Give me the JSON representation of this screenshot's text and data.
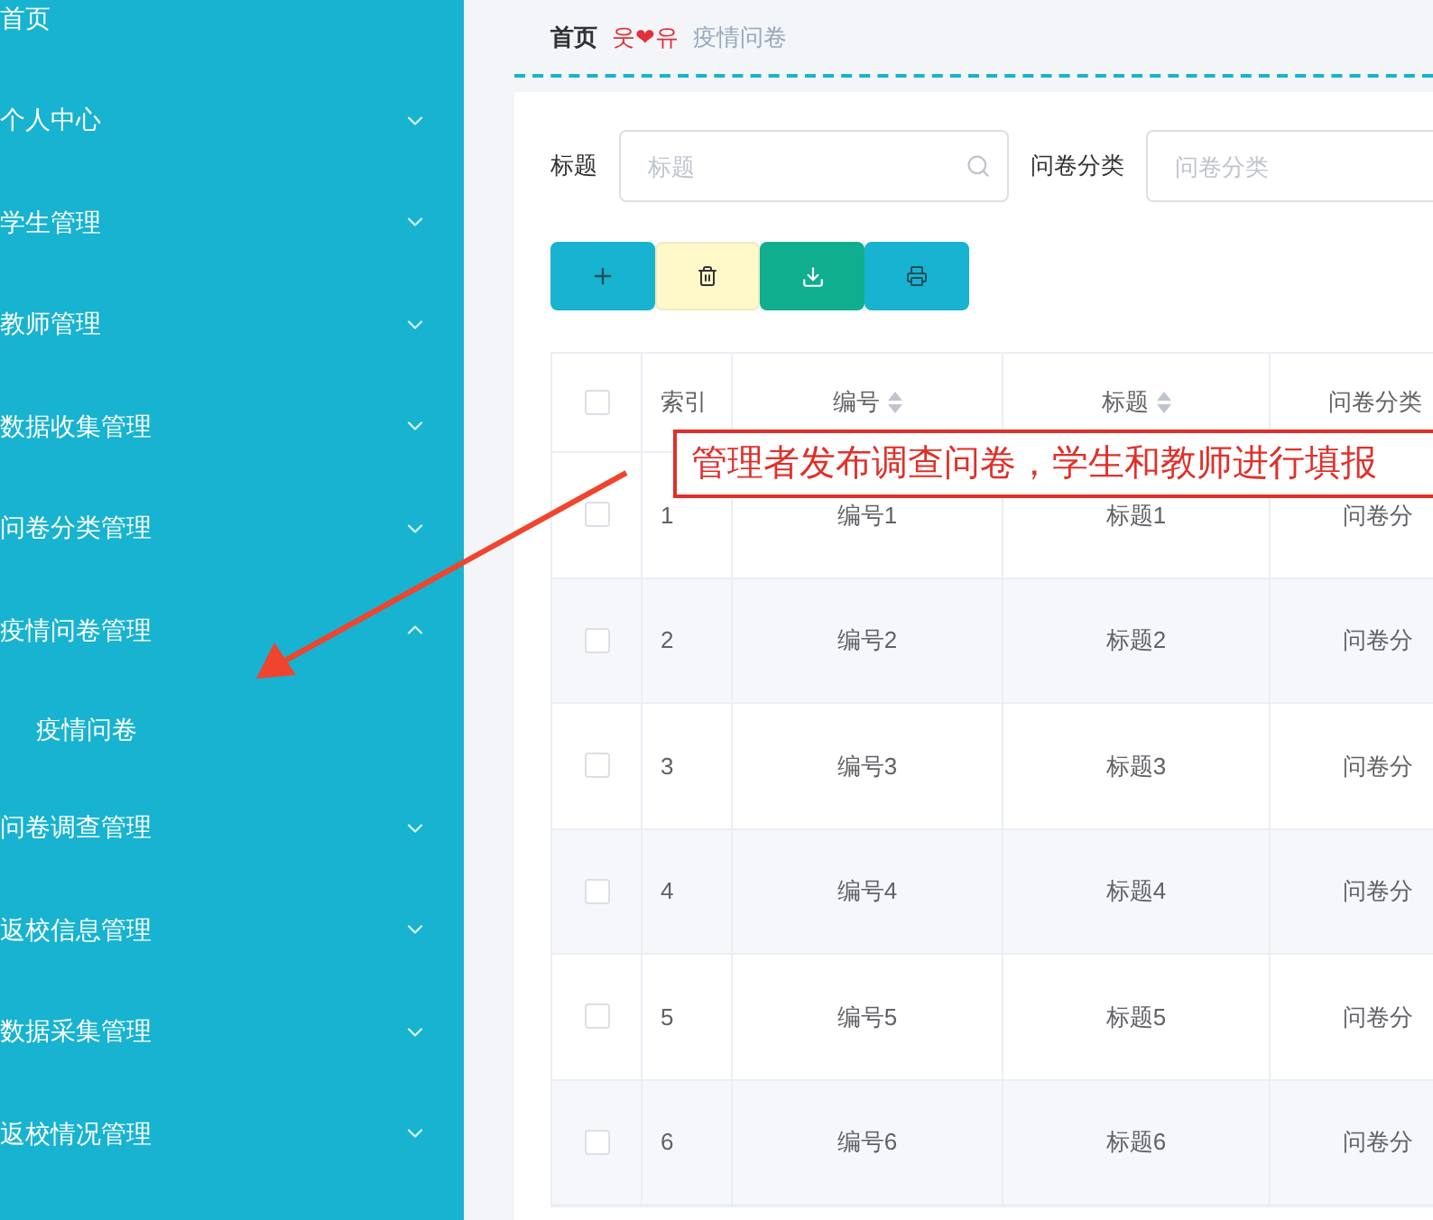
{
  "sidebar": {
    "items": [
      {
        "label": "首页",
        "kind": "link"
      },
      {
        "label": "个人中心",
        "kind": "group",
        "expanded": false
      },
      {
        "label": "学生管理",
        "kind": "group",
        "expanded": false
      },
      {
        "label": "教师管理",
        "kind": "group",
        "expanded": false
      },
      {
        "label": "数据收集管理",
        "kind": "group",
        "expanded": false
      },
      {
        "label": "问卷分类管理",
        "kind": "group",
        "expanded": false
      },
      {
        "label": "疫情问卷管理",
        "kind": "group",
        "expanded": true,
        "children": [
          {
            "label": "疫情问卷"
          }
        ]
      },
      {
        "label": "问卷调查管理",
        "kind": "group",
        "expanded": false
      },
      {
        "label": "返校信息管理",
        "kind": "group",
        "expanded": false
      },
      {
        "label": "数据采集管理",
        "kind": "group",
        "expanded": false
      },
      {
        "label": "返校情况管理",
        "kind": "group",
        "expanded": false
      }
    ]
  },
  "breadcrumb": {
    "home": "首页",
    "separator": "웃❤유",
    "current": "疫情问卷"
  },
  "filters": [
    {
      "label": "标题",
      "placeholder": "标题",
      "kind": "search"
    },
    {
      "label": "问卷分类",
      "placeholder": "问卷分类",
      "kind": "text"
    }
  ],
  "toolbar": [
    {
      "kind": "add"
    },
    {
      "kind": "delete"
    },
    {
      "kind": "export"
    },
    {
      "kind": "print"
    }
  ],
  "table": {
    "all_checked": false,
    "columns": [
      {
        "label": "索引",
        "sortable": false
      },
      {
        "label": "编号",
        "sortable": true
      },
      {
        "label": "标题",
        "sortable": true
      },
      {
        "label": "问卷分类",
        "sortable": false
      }
    ],
    "rows": [
      {
        "checked": false,
        "cells": [
          "1",
          "编号1",
          "标题1",
          "问卷分"
        ]
      },
      {
        "checked": false,
        "cells": [
          "2",
          "编号2",
          "标题2",
          "问卷分"
        ]
      },
      {
        "checked": false,
        "cells": [
          "3",
          "编号3",
          "标题3",
          "问卷分"
        ]
      },
      {
        "checked": false,
        "cells": [
          "4",
          "编号4",
          "标题4",
          "问卷分"
        ]
      },
      {
        "checked": false,
        "cells": [
          "5",
          "编号5",
          "标题5",
          "问卷分"
        ]
      },
      {
        "checked": false,
        "cells": [
          "6",
          "编号6",
          "标题6",
          "问卷分"
        ]
      }
    ]
  },
  "annotation": {
    "text": "管理者发布调查问卷，学生和教师进行填报"
  }
}
